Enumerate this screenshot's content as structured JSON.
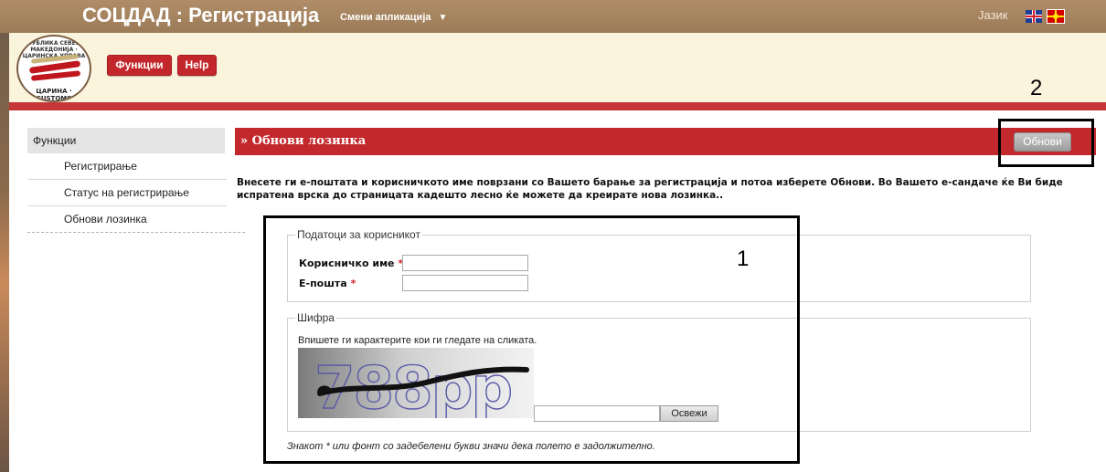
{
  "header": {
    "app_title": "СОЦДАД : Регистрација",
    "switch_app": "Смени апликација",
    "language_label": "Јазик",
    "buttons": {
      "functions": "Функции",
      "help": "Help"
    },
    "logo": {
      "top_text": "РЕПУБЛИКА СЕВЕРНА МАКЕДОНИЈА · ЦАРИНСКА УПРАВА",
      "bottom_text": "ЦАРИНА · CUSTOMS"
    }
  },
  "sidebar": {
    "heading": "Функции",
    "items": [
      {
        "label": "Регистрирање"
      },
      {
        "label": "Статус на регистрирање"
      },
      {
        "label": "Обнови лозинка"
      }
    ]
  },
  "main": {
    "page_title": "» Обнови лозинка",
    "refresh_button": "Обнови",
    "intro": "Внесете ги е-поштата и корисничкото име поврзани со Вашето барање за регистрација и потоа изберете Обнови. Во Вашето е-сандаче ќе Ви биде испратена врска до страницата кадешто лесно ќе можете да креирате нова лозинка..",
    "user_fieldset": {
      "legend": "Податоци за корисникот",
      "username_label": "Корисничко име",
      "email_label": "Е-пошта",
      "required_mark": "*",
      "username_value": "",
      "email_value": ""
    },
    "captcha_fieldset": {
      "legend": "Шифра",
      "hint": "Впишете ги карактерите кои ги гледате на сликата.",
      "captcha_text": "788pp",
      "input_value": "",
      "refresh_label": "Освежи"
    },
    "note": "Знакот * или фонт со задебелени букви значи дека полето е задолжително."
  },
  "annotations": {
    "box1_label": "1",
    "box2_label": "2"
  },
  "colors": {
    "topbar": "#a88562",
    "header_band": "#fbf4dd",
    "brand_red": "#c3282d",
    "sidebar_heading_bg": "#e4e4e4"
  }
}
